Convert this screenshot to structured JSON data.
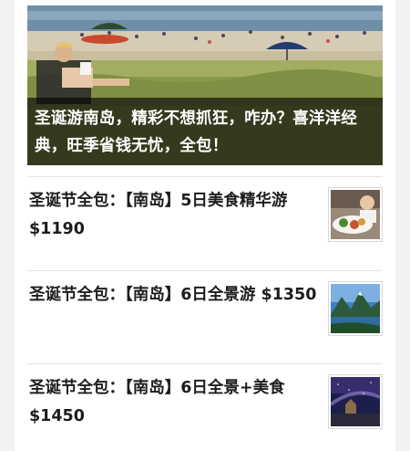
{
  "hero": {
    "caption": "圣诞游南岛，精彩不想抓狂，咋办？喜洋洋经典，旺季省钱无忧，全包！",
    "image": "beach-picnic-photo"
  },
  "articles": [
    {
      "title": "圣诞节全包：【南岛】5日美食精华游 $1190",
      "thumbnail": "food-platter-photo"
    },
    {
      "title": "圣诞节全包：【南岛】6日全景游 $1350",
      "thumbnail": "mountain-lake-photo"
    },
    {
      "title": "圣诞节全包：【南岛】6日全景+美食 $1450",
      "thumbnail": "night-sky-church-photo"
    }
  ]
}
